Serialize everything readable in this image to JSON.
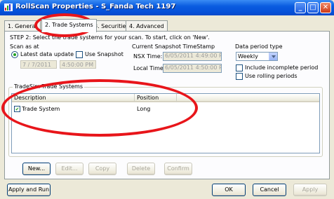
{
  "window": {
    "title": "RollScan Properties - S_Fanda Tech 1197"
  },
  "title_buttons": {
    "minimize": "_",
    "maximize": "□",
    "close": "✕"
  },
  "tabs": [
    {
      "label": "1. General"
    },
    {
      "label": "2. Trade Systems"
    },
    {
      "label": "3. Securities"
    },
    {
      "label": "4. Advanced"
    }
  ],
  "step_text": "STEP 2: Select the trade systems for your scan. To start, click on 'New'.",
  "scan_as_at": {
    "label": "Scan as at",
    "latest_label": "Latest data update",
    "latest_selected": true,
    "snapshot_label": "Use Snapshot",
    "snapshot_checked": false,
    "date_value": "7 / 7/2011",
    "time_value": "4:50:00 PM"
  },
  "snapshot": {
    "heading": "Current Snapshot TimeStamp",
    "nsx_label": "NSX Time:",
    "nsx_value": "6/05/2011 4:49:00 PM",
    "local_label": "Local Time:",
    "local_value": "6/05/2011 4:50:00 PM"
  },
  "data_period": {
    "label": "Data period type",
    "value": "Weekly",
    "options": [
      "Weekly"
    ],
    "include_incomplete_label": "Include incomplete period",
    "include_incomplete_checked": false,
    "use_rolling_label": "Use rolling periods",
    "use_rolling_checked": false
  },
  "trade_systems": {
    "group_label": "TradeSim Trade Systems",
    "columns": [
      "Description",
      "Position"
    ],
    "rows": [
      {
        "checked": true,
        "description": "Trade System",
        "position": "Long"
      }
    ]
  },
  "list_buttons": [
    "New...",
    "Edit...",
    "Copy",
    "Delete",
    "Confirm"
  ],
  "bottom_buttons": {
    "apply_run": "Apply and Run",
    "ok": "OK",
    "cancel": "Cancel",
    "apply": "Apply"
  },
  "check_glyph": "✔",
  "colors": {
    "annotation_red": "#e8151a",
    "title_blue": "#0a5ce0",
    "dialog_bg": "#ece9d8"
  }
}
